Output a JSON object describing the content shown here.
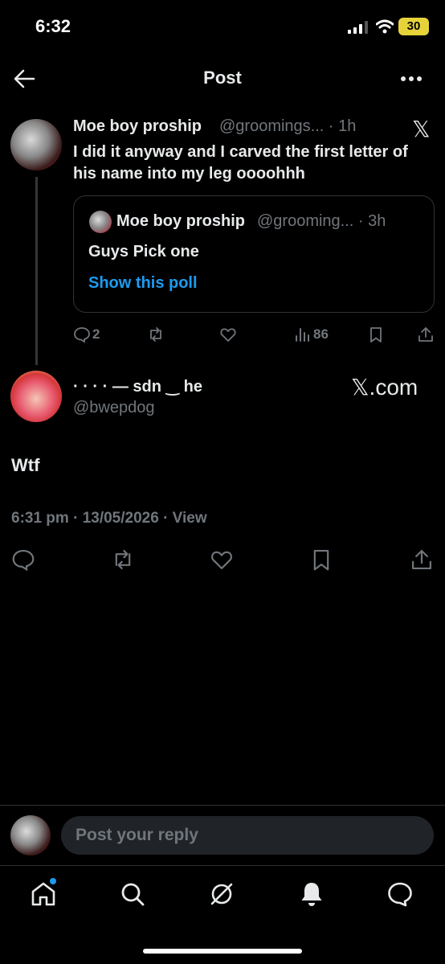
{
  "status_bar": {
    "time": "6:32",
    "battery": "30"
  },
  "header": {
    "title": "Post"
  },
  "parent_post": {
    "author_name": "Moe boy proship",
    "handle_time": "@groomings... · 1h",
    "text": "I did it anyway and I carved the first letter of his name into my leg oooohhh",
    "quoted": {
      "author_name": "Moe boy proship",
      "handle_time": "@grooming... · 3h",
      "text": "Guys Pick one",
      "link": "Show this poll"
    },
    "stats": {
      "replies": "2",
      "views": "86"
    }
  },
  "main_post": {
    "author_name": "· · · · — sdn ‿ he",
    "handle": "@bwepdog",
    "source_badge": "𝕏.com",
    "text": "Wtf",
    "meta": "6:31 pm · 13/05/2026 · View"
  },
  "reply_bar": {
    "placeholder": "Post your reply"
  },
  "icons": {
    "back": "arrow-left-icon",
    "more": "more-icon",
    "x": "x-logo-icon",
    "reply": "reply-icon",
    "repost": "repost-icon",
    "like": "like-icon",
    "bookmark": "bookmark-icon",
    "share": "share-icon",
    "views": "views-icon",
    "home": "home-icon",
    "search": "search-icon",
    "grok": "grok-icon",
    "notifications": "bell-icon",
    "messages": "messages-icon"
  },
  "colors": {
    "accent": "#1d9bf0",
    "muted": "#71767b",
    "background": "#000000"
  }
}
